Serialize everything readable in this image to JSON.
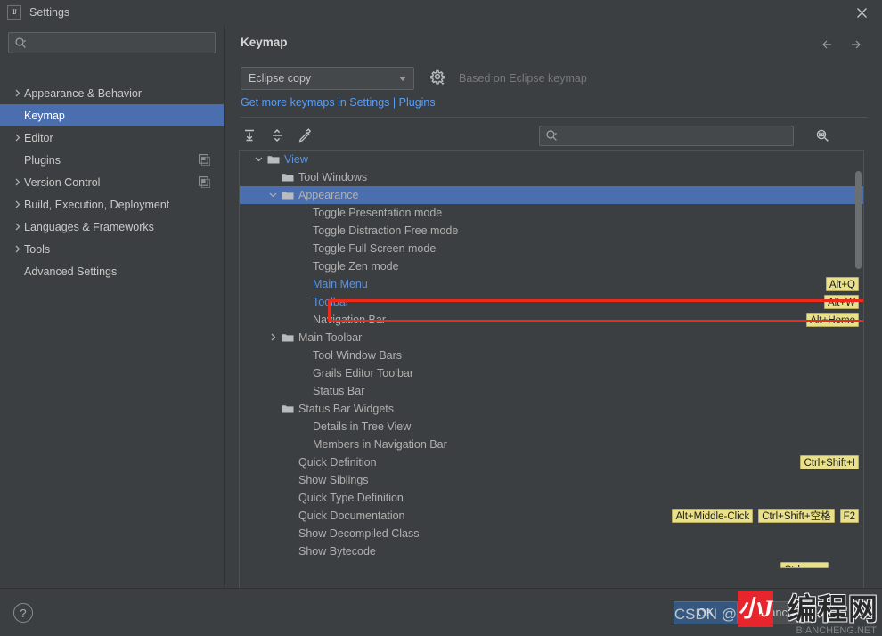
{
  "window": {
    "title": "Settings",
    "app_icon": "intellij-idea-icon",
    "close_icon": "close-icon"
  },
  "sidebar": {
    "search": {
      "placeholder": "",
      "value": "",
      "icon": "search-icon"
    },
    "items": [
      {
        "label": "Appearance & Behavior",
        "expandable": true,
        "selected": false,
        "trailing_icon": ""
      },
      {
        "label": "Keymap",
        "expandable": false,
        "selected": true,
        "trailing_icon": ""
      },
      {
        "label": "Editor",
        "expandable": true,
        "selected": false,
        "trailing_icon": ""
      },
      {
        "label": "Plugins",
        "expandable": false,
        "selected": false,
        "trailing_icon": "copy-icon"
      },
      {
        "label": "Version Control",
        "expandable": true,
        "selected": false,
        "trailing_icon": "copy-icon"
      },
      {
        "label": "Build, Execution, Deployment",
        "expandable": true,
        "selected": false,
        "trailing_icon": ""
      },
      {
        "label": "Languages & Frameworks",
        "expandable": true,
        "selected": false,
        "trailing_icon": ""
      },
      {
        "label": "Tools",
        "expandable": true,
        "selected": false,
        "trailing_icon": ""
      },
      {
        "label": "Advanced Settings",
        "expandable": false,
        "selected": false,
        "trailing_icon": ""
      }
    ]
  },
  "main": {
    "panel_title": "Keymap",
    "back_icon": "arrow-left-icon",
    "forward_icon": "arrow-right-icon",
    "keymap_select": {
      "value": "Eclipse copy",
      "caret_icon": "chevron-down-icon"
    },
    "gear_icon": "gear-icon",
    "based_on": "Based on Eclipse keymap",
    "keymaps_link": "Get more keymaps in Settings | Plugins",
    "toolbar": {
      "expand_all": "expand-all-icon",
      "collapse_all": "collapse-all-icon",
      "edit_shortcut": "pencil-edit-icon",
      "find_by_shortcut": "find-by-shortcut-icon"
    },
    "tree_search": {
      "placeholder": "",
      "value": "",
      "icon": "search-icon"
    }
  },
  "tree": {
    "rows": [
      {
        "label": "View",
        "indent": 0,
        "type": "folder",
        "twisty": "down",
        "selected": false,
        "style": "link",
        "shortcuts": []
      },
      {
        "label": "Tool Windows",
        "indent": 1,
        "type": "folder",
        "twisty": "none",
        "selected": false,
        "style": "dim",
        "shortcuts": []
      },
      {
        "label": "Appearance",
        "indent": 1,
        "type": "folder",
        "twisty": "down",
        "selected": true,
        "style": "dim",
        "shortcuts": []
      },
      {
        "label": "Toggle Presentation mode",
        "indent": 2,
        "type": "action",
        "twisty": "none",
        "selected": false,
        "style": "dim",
        "shortcuts": []
      },
      {
        "label": "Toggle Distraction Free mode",
        "indent": 2,
        "type": "action",
        "twisty": "none",
        "selected": false,
        "style": "dim",
        "shortcuts": []
      },
      {
        "label": "Toggle Full Screen mode",
        "indent": 2,
        "type": "action",
        "twisty": "none",
        "selected": false,
        "style": "dim",
        "shortcuts": []
      },
      {
        "label": "Toggle Zen mode",
        "indent": 2,
        "type": "action",
        "twisty": "none",
        "selected": false,
        "style": "dim",
        "shortcuts": []
      },
      {
        "label": "Main Menu",
        "indent": 2,
        "type": "action",
        "twisty": "none",
        "selected": false,
        "style": "link",
        "shortcuts": [
          "Alt+Q"
        ]
      },
      {
        "label": "Toolbar",
        "indent": 2,
        "type": "action",
        "twisty": "none",
        "selected": false,
        "style": "link",
        "shortcuts": [
          "Alt+W"
        ]
      },
      {
        "label": "Navigation Bar",
        "indent": 2,
        "type": "action",
        "twisty": "none",
        "selected": false,
        "style": "dim",
        "shortcuts": [
          "Alt+Home"
        ]
      },
      {
        "label": "Main Toolbar",
        "indent": 1,
        "type": "folder",
        "twisty": "right",
        "selected": false,
        "style": "dim",
        "shortcuts": []
      },
      {
        "label": "Tool Window Bars",
        "indent": 2,
        "type": "action",
        "twisty": "none",
        "selected": false,
        "style": "dim",
        "shortcuts": []
      },
      {
        "label": "Grails Editor Toolbar",
        "indent": 2,
        "type": "action",
        "twisty": "none",
        "selected": false,
        "style": "dim",
        "shortcuts": []
      },
      {
        "label": "Status Bar",
        "indent": 2,
        "type": "action",
        "twisty": "none",
        "selected": false,
        "style": "dim",
        "shortcuts": []
      },
      {
        "label": "Status Bar Widgets",
        "indent": 1,
        "type": "folder",
        "twisty": "none",
        "selected": false,
        "style": "dim",
        "shortcuts": []
      },
      {
        "label": "Details in Tree View",
        "indent": 2,
        "type": "action",
        "twisty": "none",
        "selected": false,
        "style": "dim",
        "shortcuts": []
      },
      {
        "label": "Members in Navigation Bar",
        "indent": 2,
        "type": "action",
        "twisty": "none",
        "selected": false,
        "style": "dim",
        "shortcuts": []
      },
      {
        "label": "Quick Definition",
        "indent": 1,
        "type": "action",
        "twisty": "none",
        "selected": false,
        "style": "dim",
        "shortcuts": [
          "Ctrl+Shift+I"
        ]
      },
      {
        "label": "Show Siblings",
        "indent": 1,
        "type": "action",
        "twisty": "none",
        "selected": false,
        "style": "dim",
        "shortcuts": []
      },
      {
        "label": "Quick Type Definition",
        "indent": 1,
        "type": "action",
        "twisty": "none",
        "selected": false,
        "style": "dim",
        "shortcuts": []
      },
      {
        "label": "Quick Documentation",
        "indent": 1,
        "type": "action",
        "twisty": "none",
        "selected": false,
        "style": "dim",
        "shortcuts": [
          "Alt+Middle-Click",
          "Ctrl+Shift+空格",
          "F2"
        ]
      },
      {
        "label": "Show Decompiled Class",
        "indent": 1,
        "type": "action",
        "twisty": "none",
        "selected": false,
        "style": "dim",
        "shortcuts": []
      },
      {
        "label": "Show Bytecode",
        "indent": 1,
        "type": "action",
        "twisty": "none",
        "selected": false,
        "style": "dim",
        "shortcuts": []
      }
    ],
    "clipped_badge": "Ctrl+"
  },
  "annotation": {
    "highlight_target": "Main Menu",
    "color": "#ee2b1a"
  },
  "footer": {
    "help_label": "?",
    "ok_label": "OK",
    "cancel_label": "Cancel"
  },
  "watermark": {
    "csdn": "CSDN @",
    "logo_glyph": "小J",
    "chinese": "编程网",
    "sub": "BIANCHENG.NET"
  },
  "colors": {
    "selection_blue": "#4b6eaf",
    "link_blue": "#589df6",
    "shortcut_badge": "#e9e08a",
    "annotation_red": "#ee2b1a",
    "ok_button": "#365880"
  }
}
